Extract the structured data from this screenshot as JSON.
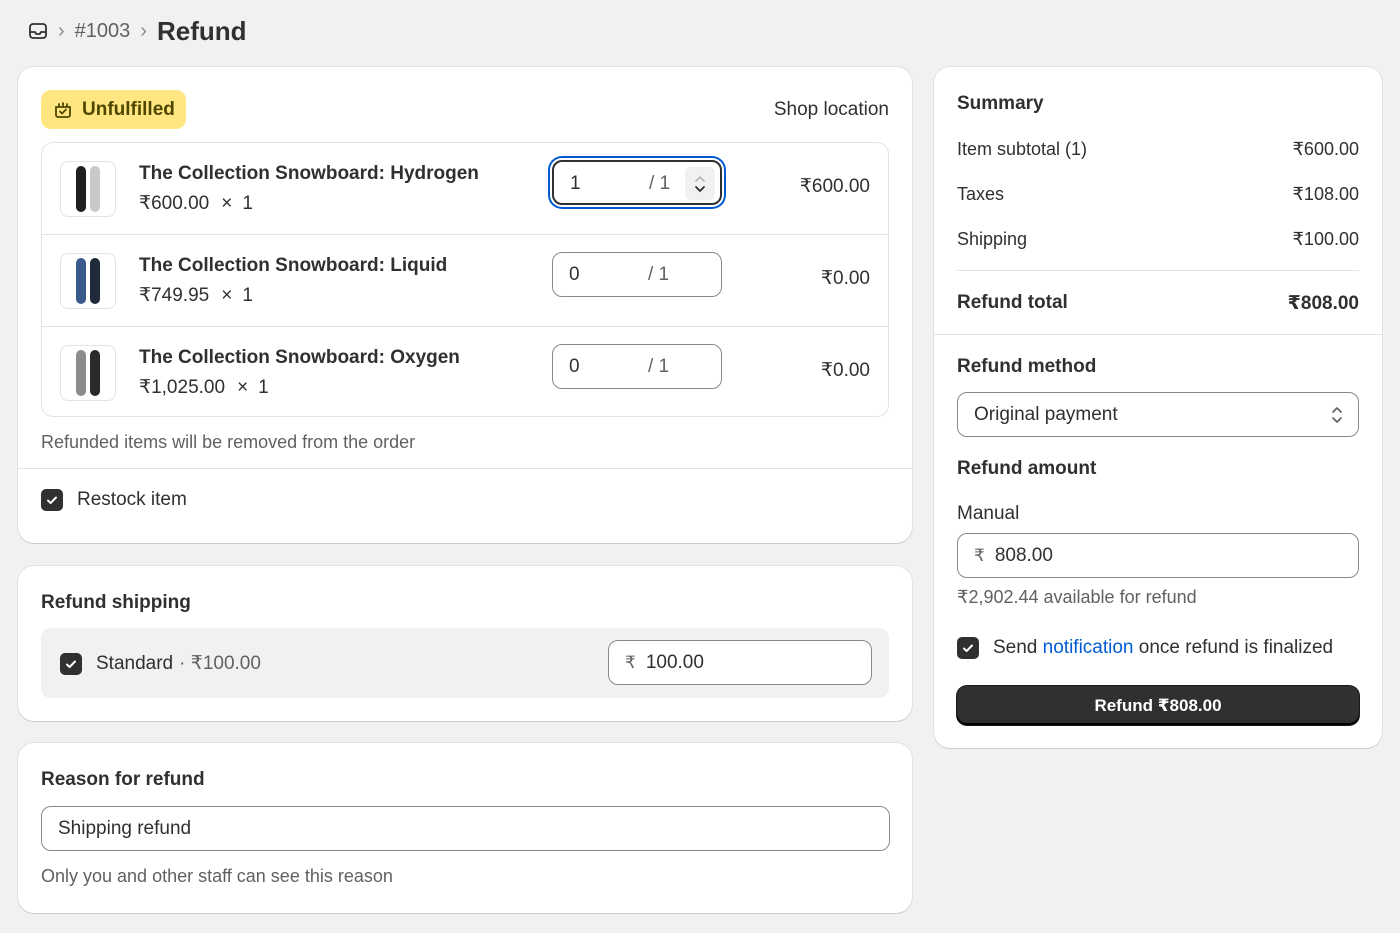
{
  "breadcrumb": {
    "order": "#1003",
    "title": "Refund"
  },
  "items_card": {
    "status_badge": "Unfulfilled",
    "location": "Shop location",
    "items": [
      {
        "name": "The Collection Snowboard: Hydrogen",
        "unit_price": "₹600.00",
        "times": "×",
        "ordered_qty": "1",
        "refund_qty": "1",
        "max_qty": "/ 1",
        "total": "₹600.00"
      },
      {
        "name": "The Collection Snowboard: Liquid",
        "unit_price": "₹749.95",
        "times": "×",
        "ordered_qty": "1",
        "refund_qty": "0",
        "max_qty": "/ 1",
        "total": "₹0.00"
      },
      {
        "name": "The Collection Snowboard: Oxygen",
        "unit_price": "₹1,025.00",
        "times": "×",
        "ordered_qty": "1",
        "refund_qty": "0",
        "max_qty": "/ 1",
        "total": "₹0.00"
      }
    ],
    "note": "Refunded items will be removed from the order",
    "restock_label": "Restock item"
  },
  "shipping_card": {
    "title": "Refund shipping",
    "method": "Standard",
    "method_price": "· ₹100.00",
    "currency_symbol": "₹",
    "amount": "100.00"
  },
  "reason_card": {
    "title": "Reason for refund",
    "value": "Shipping refund",
    "help": "Only you and other staff can see this reason"
  },
  "summary": {
    "title": "Summary",
    "rows": [
      {
        "label": "Item subtotal (1)",
        "value": "₹600.00"
      },
      {
        "label": "Taxes",
        "value": "₹108.00"
      },
      {
        "label": "Shipping",
        "value": "₹100.00"
      }
    ],
    "total_label": "Refund total",
    "total_value": "₹808.00",
    "method_title": "Refund method",
    "method_value": "Original payment",
    "amount_title": "Refund amount",
    "manual_label": "Manual",
    "currency_symbol": "₹",
    "manual_amount": "808.00",
    "available": "₹2,902.44 available for refund",
    "notify_prefix": "Send",
    "notify_link": "notification",
    "notify_suffix": "once refund is finalized",
    "button": "Refund ₹808.00"
  },
  "colors": {
    "badge_bg": "#ffe680",
    "primary_button": "#303030",
    "link": "#005bd3",
    "focus_ring": "#005bd3"
  }
}
